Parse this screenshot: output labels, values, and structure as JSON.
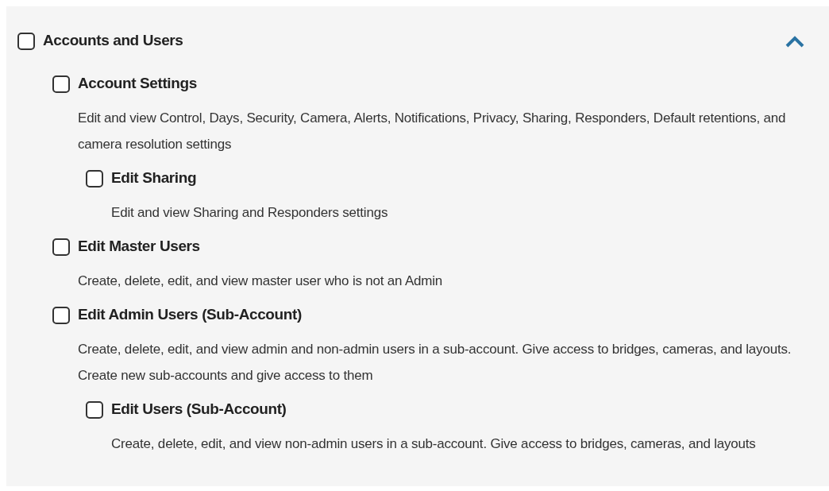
{
  "tree": {
    "title": "Accounts and Users",
    "checked": false,
    "expanded": true,
    "children": [
      {
        "title": "Account Settings",
        "checked": false,
        "description": "Edit and view Control, Days, Security, Camera, Alerts, Notifications, Privacy, Sharing, Responders, Default retentions, and camera resolution settings",
        "children": [
          {
            "title": "Edit Sharing",
            "checked": false,
            "description": "Edit and view Sharing and Responders settings"
          }
        ]
      },
      {
        "title": "Edit Master Users",
        "checked": false,
        "description": "Create, delete, edit, and view master user who is not an Admin"
      },
      {
        "title": "Edit Admin Users (Sub-Account)",
        "checked": false,
        "description": "Create, delete, edit, and view admin and non-admin users in a sub-account. Give access to bridges, cameras, and layouts. Create new sub-accounts and give access to them",
        "children": [
          {
            "title": "Edit Users (Sub-Account)",
            "checked": false,
            "description": "Create, delete, edit, and view non-admin users in a sub-account. Give access to bridges, cameras, and layouts"
          }
        ]
      }
    ]
  }
}
